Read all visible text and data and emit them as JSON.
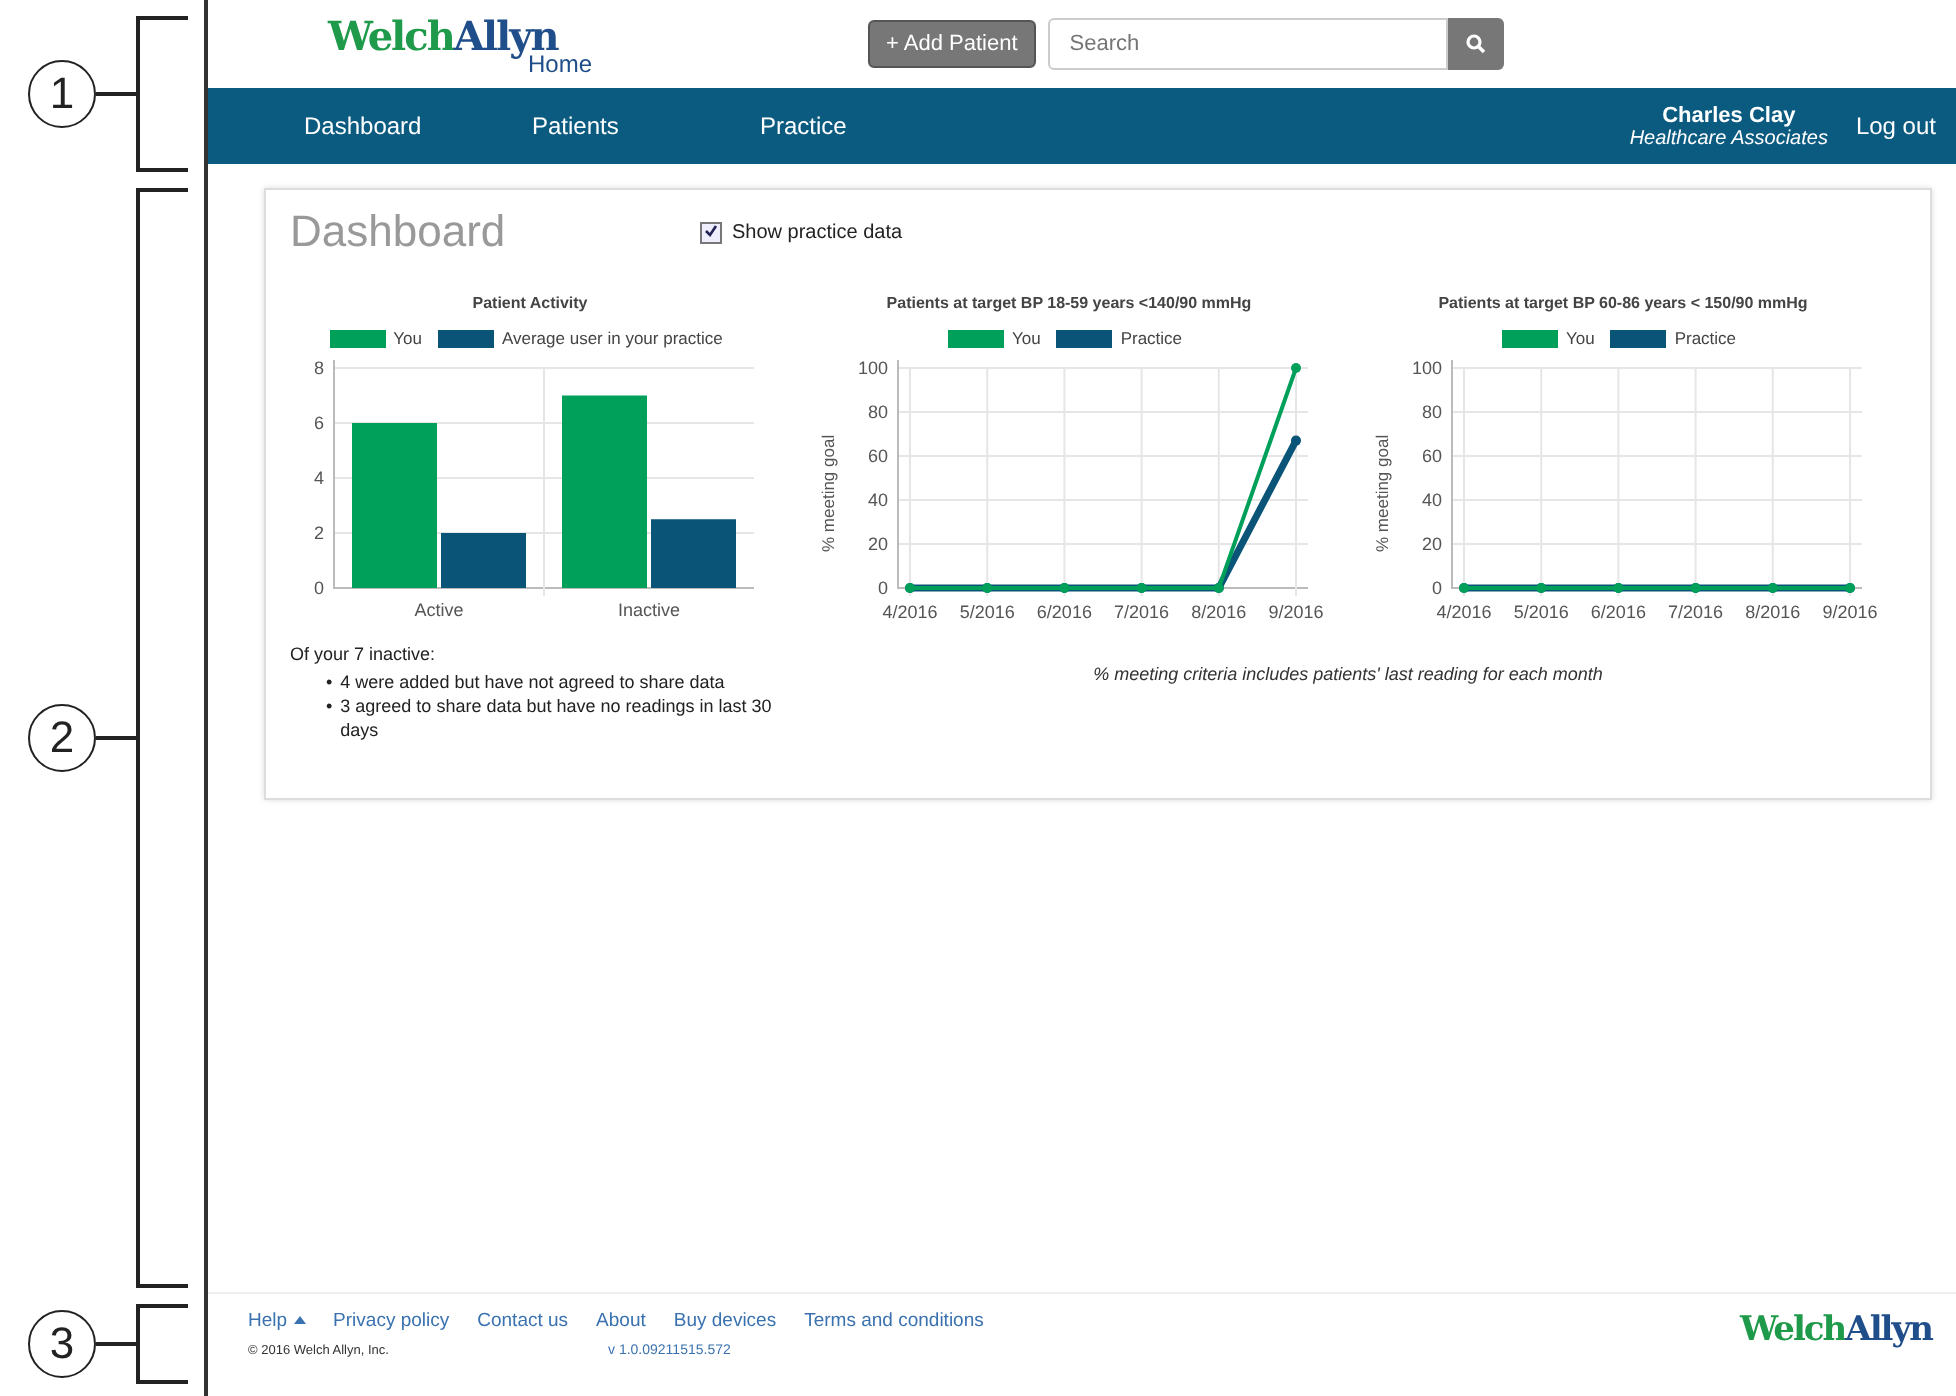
{
  "callouts": [
    {
      "label": "1"
    },
    {
      "label": "2"
    },
    {
      "label": "3"
    }
  ],
  "header": {
    "logo": {
      "first": "Welch",
      "second": "Allyn",
      "sub": "Home"
    },
    "add_button": "+ Add Patient",
    "search": {
      "placeholder": "Search"
    }
  },
  "nav": {
    "items": [
      {
        "label": "Dashboard"
      },
      {
        "label": "Patients"
      },
      {
        "label": "Practice"
      }
    ],
    "user": {
      "name": "Charles Clay",
      "org": "Healthcare Associates"
    },
    "logout": "Log out"
  },
  "dashboard": {
    "title": "Dashboard",
    "show_practice": {
      "label": "Show practice data",
      "checked": true
    },
    "charts": [
      {
        "chart_data": {
          "type": "bar",
          "grid": true,
          "title": "Patient Activity",
          "categories": [
            "Active",
            "Inactive"
          ],
          "series": [
            {
              "name": "You",
              "color": "#00a05a",
              "values": [
                6,
                7
              ]
            },
            {
              "name": "Average user in your practice",
              "color": "#0a5478",
              "values": [
                2,
                2.5
              ]
            }
          ],
          "ylim": [
            0,
            8
          ],
          "yticks": [
            0,
            2,
            4,
            6,
            8
          ]
        }
      },
      {
        "chart_data": {
          "type": "line",
          "grid": true,
          "title": "Patients at target BP 18-59 years <140/90 mmHg",
          "ylabel": "% meeting goal",
          "x": [
            "4/2016",
            "5/2016",
            "6/2016",
            "7/2016",
            "8/2016",
            "9/2016"
          ],
          "series": [
            {
              "name": "You",
              "color": "#00a05a",
              "marker": "circle",
              "values": [
                0,
                0,
                0,
                0,
                0,
                100
              ]
            },
            {
              "name": "Practice",
              "color": "#0a5478",
              "marker": "circle",
              "values": [
                0,
                0,
                0,
                0,
                0,
                67
              ]
            }
          ],
          "ylim": [
            0,
            100
          ],
          "yticks": [
            0,
            20,
            40,
            60,
            80,
            100
          ]
        }
      },
      {
        "chart_data": {
          "type": "line",
          "grid": true,
          "title": "Patients at target BP 60-86 years < 150/90 mmHg",
          "ylabel": "% meeting goal",
          "x": [
            "4/2016",
            "5/2016",
            "6/2016",
            "7/2016",
            "8/2016",
            "9/2016"
          ],
          "series": [
            {
              "name": "You",
              "color": "#00a05a",
              "marker": "circle",
              "values": [
                0,
                0,
                0,
                0,
                0,
                0
              ]
            },
            {
              "name": "Practice",
              "color": "#0a5478",
              "marker": "circle",
              "values": [
                0,
                0,
                0,
                0,
                0,
                0
              ]
            }
          ],
          "ylim": [
            0,
            100
          ],
          "yticks": [
            0,
            20,
            40,
            60,
            80,
            100
          ]
        }
      }
    ],
    "inactive_heading": "Of your 7 inactive:",
    "inactive_notes": [
      {
        "bullet": "•",
        "text": "4 were added but have not agreed to share data"
      },
      {
        "bullet": "•",
        "text": "3 agreed to share data but have no readings in last 30 days"
      }
    ],
    "caption": "% meeting criteria includes patients' last reading for each month"
  },
  "footer": {
    "links": [
      {
        "label": "Help",
        "kind": "menu"
      },
      {
        "label": "Privacy policy",
        "kind": "link"
      },
      {
        "label": "Contact us",
        "kind": "link"
      },
      {
        "label": "About",
        "kind": "link"
      },
      {
        "label": "Buy devices",
        "kind": "link"
      },
      {
        "label": "Terms and conditions",
        "kind": "link"
      }
    ],
    "copyright": "© 2016 Welch Allyn, Inc.",
    "version": "v 1.0.09211515.572",
    "logo": {
      "first": "Welch",
      "second": "Allyn"
    }
  }
}
